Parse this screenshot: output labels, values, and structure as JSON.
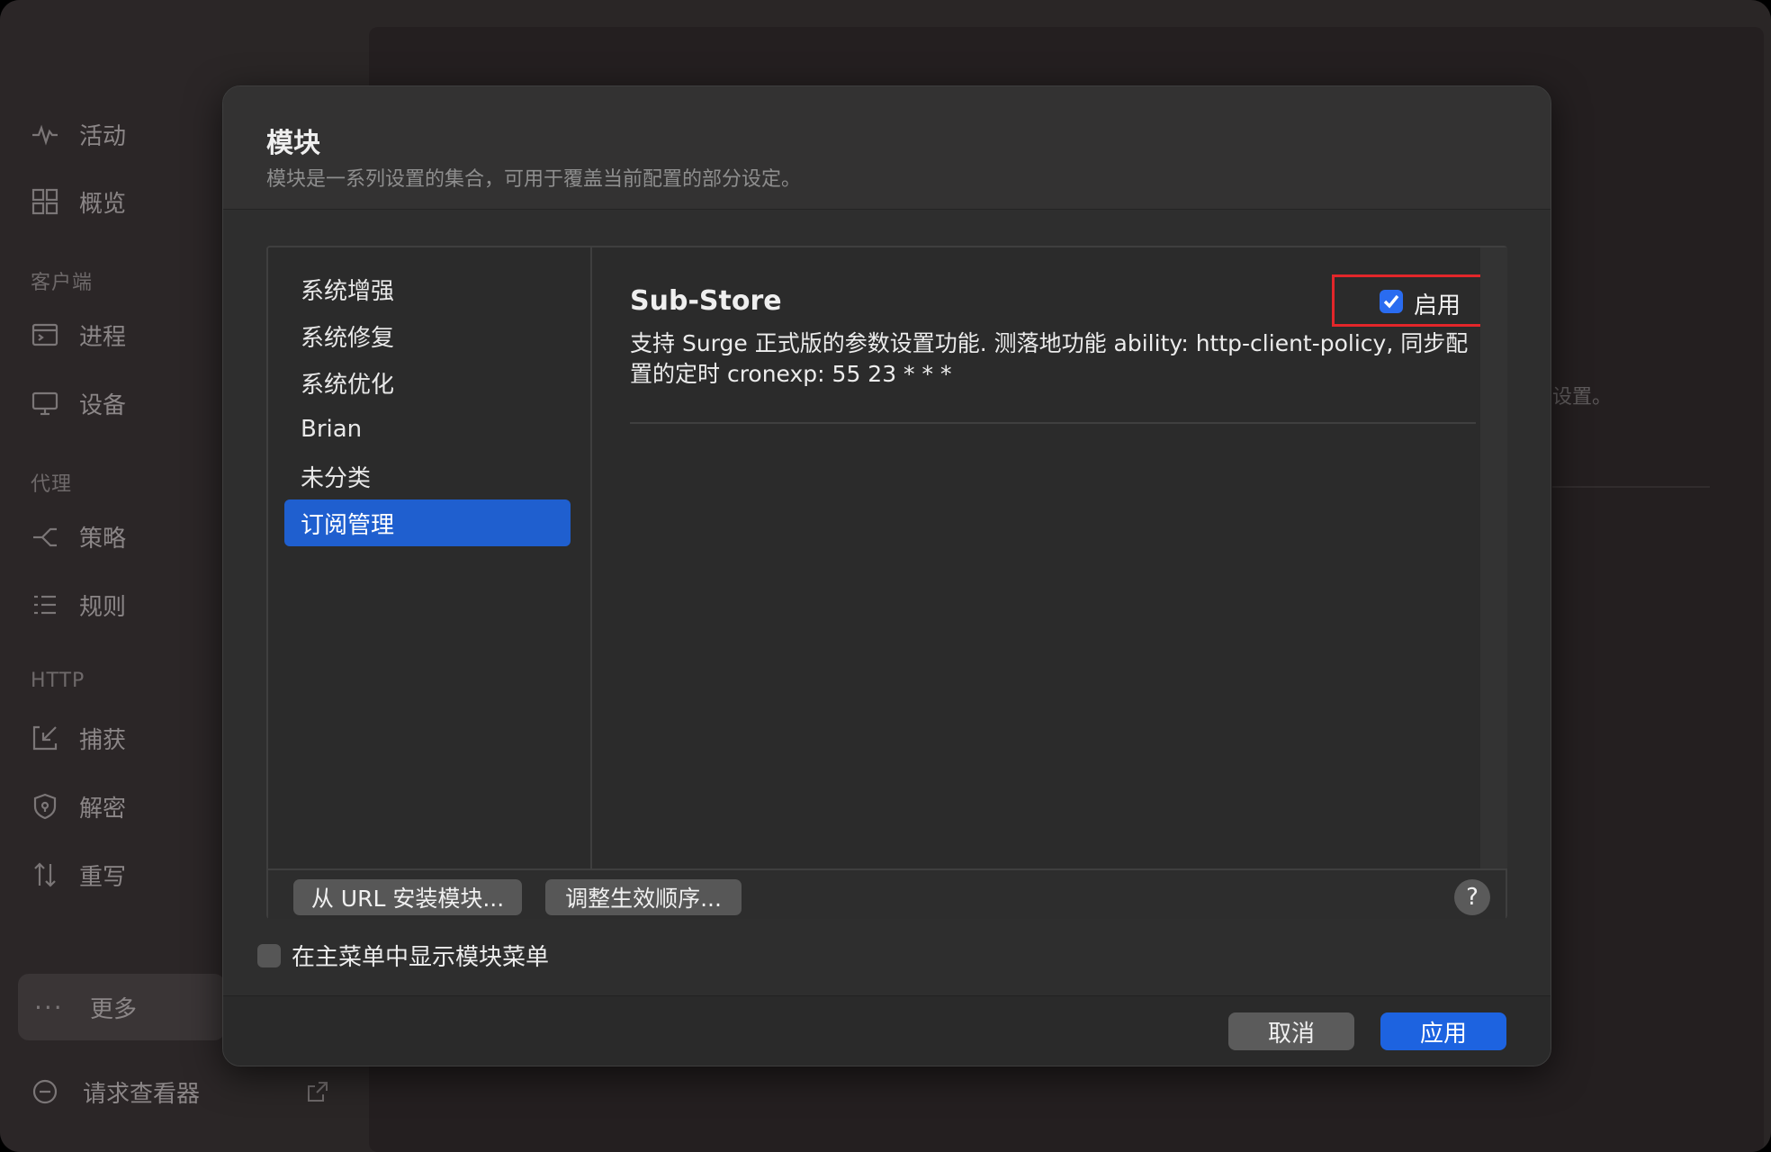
{
  "sidebar": {
    "items": [
      {
        "label": "活动",
        "icon": "activity-icon"
      },
      {
        "label": "概览",
        "icon": "overview-grid-icon"
      },
      {
        "label": "进程",
        "icon": "process-icon"
      },
      {
        "label": "设备",
        "icon": "device-monitor-icon"
      },
      {
        "label": "策略",
        "icon": "policy-icon"
      },
      {
        "label": "规则",
        "icon": "rules-list-icon"
      },
      {
        "label": "捕获",
        "icon": "capture-icon"
      },
      {
        "label": "解密",
        "icon": "shield-icon"
      },
      {
        "label": "重写",
        "icon": "rewrite-icon"
      }
    ],
    "sections": {
      "client": "客户端",
      "proxy": "代理",
      "http": "HTTP"
    },
    "more_label": "更多",
    "bottom_label": "请求查看器"
  },
  "background_hint": "设置。",
  "dialog": {
    "title": "模块",
    "subtitle": "模块是一系列设置的集合，可用于覆盖当前配置的部分设定。",
    "modules": [
      "系统增强",
      "系统修复",
      "系统优化",
      "Brian",
      "未分类",
      "订阅管理"
    ],
    "selected_module": "订阅管理",
    "detail": {
      "name": "Sub-Store",
      "description": "支持 Surge 正式版的参数设置功能. 测落地功能 ability: http-client-policy, 同步配置的定时 cronexp: 55 23 * * *",
      "enable_label": "启用",
      "enabled": true
    },
    "toolbar": {
      "install_url": "从 URL 安装模块...",
      "reorder": "调整生效顺序...",
      "help": "?"
    },
    "show_in_menu_label": "在主菜单中显示模块菜单",
    "show_in_menu_checked": false,
    "cancel_label": "取消",
    "apply_label": "应用"
  },
  "colors": {
    "accent": "#1f5fcf",
    "highlight_border": "#e3262a",
    "apply_button": "#1d63e0"
  }
}
